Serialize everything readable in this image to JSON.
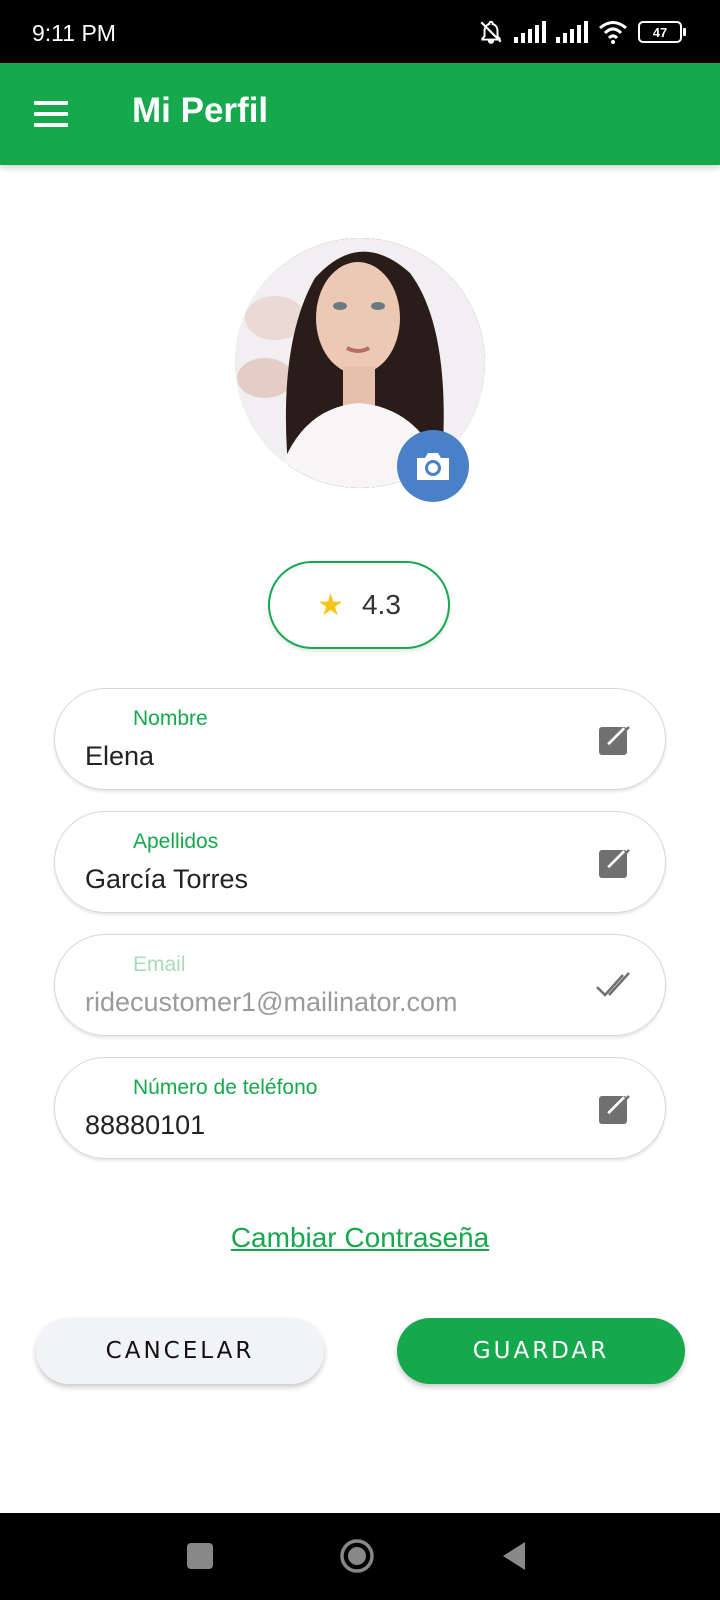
{
  "status_bar": {
    "time": "9:11 PM",
    "battery": "47",
    "icons": [
      "bell-off-icon",
      "signal-icon",
      "signal-icon",
      "wifi-icon",
      "battery-icon"
    ]
  },
  "app_bar": {
    "title": "Mi Perfil",
    "menu_icon": "hamburger-menu-icon"
  },
  "profile": {
    "camera_icon": "camera-icon"
  },
  "rating": {
    "value": "4.3",
    "icon": "star-icon"
  },
  "fields": [
    {
      "label": "Nombre",
      "value": "Elena",
      "icon": "edit-icon"
    },
    {
      "label": "Apellidos",
      "value": "García Torres",
      "icon": "edit-icon"
    },
    {
      "label": "Email",
      "value": "ridecustomer1@mailinator.com",
      "icon": "double-check-icon"
    },
    {
      "label": "Número de teléfono",
      "value": "88880101",
      "icon": "edit-icon"
    }
  ],
  "change_password": "Cambiar Contraseña",
  "buttons": {
    "cancel": "CANCELAR",
    "save": "GUARDAR"
  },
  "colors": {
    "primary": "#16a84c",
    "camera_button": "#4a80c8",
    "star": "#f5c518"
  }
}
